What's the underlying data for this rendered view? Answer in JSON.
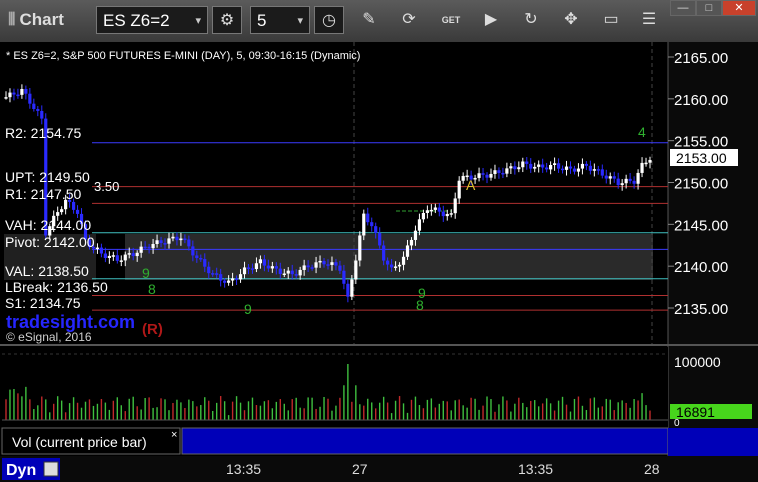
{
  "toolbar": {
    "title": "Chart",
    "symbol": "ES Z6=2",
    "interval": "5",
    "win_min": "—",
    "win_max": "□",
    "win_close": "✕"
  },
  "chart_title": "* ES Z6=2, S&P 500 FUTURES E-MINI (DAY), 5, 09:30-16:15 (Dynamic)",
  "price_axis": [
    "2165.00",
    "2160.00",
    "2155.00",
    "2150.00",
    "2145.00",
    "2140.00",
    "2135.00"
  ],
  "last_price": "2153.00",
  "levels": [
    {
      "label": "R2: 2154.75",
      "color": "#3a3aff"
    },
    {
      "label": "UPT: 2149.50",
      "color": "#b03030"
    },
    {
      "label": "R1: 2147.50",
      "color": "#b03030"
    },
    {
      "label": "VAH: 2144.00",
      "color": "#40c0c0"
    },
    {
      "label": "Pivot: 2142.00",
      "color": "#3a3aff"
    },
    {
      "label": "VAL: 2138.50",
      "color": "#40c0c0"
    },
    {
      "label": "LBreak: 2136.50",
      "color": "#b03030"
    },
    {
      "label": "S1: 2134.75",
      "color": "#b03030"
    }
  ],
  "annotations": {
    "prev_close": "3.50",
    "marker_a": "A",
    "marker_r": "(R)",
    "seq_top": "4",
    "seq9": "9",
    "seq8": "8"
  },
  "watermark": {
    "brand": "tradesight.com",
    "copyright": "© eSignal, 2016"
  },
  "volume": {
    "label": "Vol (current price bar)",
    "close_glyph": "×",
    "axis_max": "100000",
    "axis_zero": "0",
    "current": "16891"
  },
  "time_axis": [
    "13:35",
    "27",
    "13:35",
    "28"
  ],
  "status": {
    "mode": "Dyn"
  },
  "colors": {
    "up": "#ffffff",
    "down": "#2a2aff",
    "vol_up": "#3fbf3f",
    "vol_down": "#c02a2a",
    "accent": "#47d61c"
  }
}
